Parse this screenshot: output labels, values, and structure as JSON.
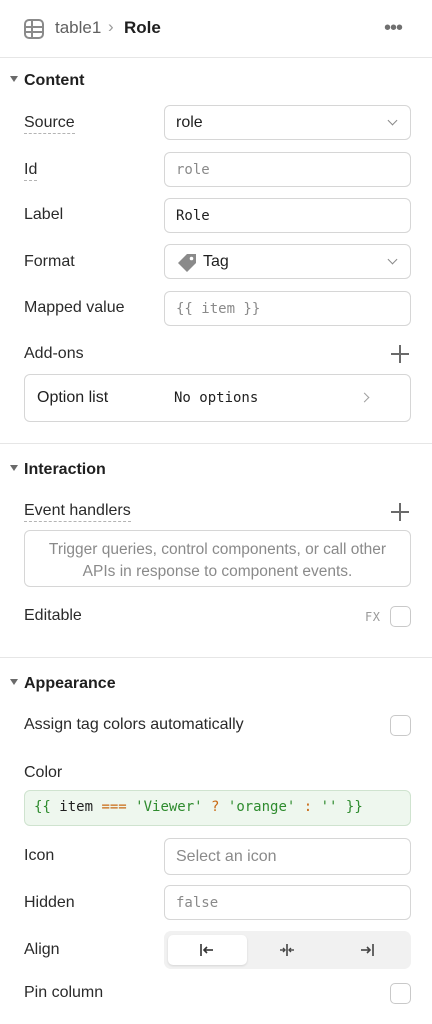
{
  "header": {
    "breadcrumb_parent": "table1",
    "breadcrumb_separator": "›",
    "breadcrumb_current": "Role",
    "more_icon": "more-horizontal-icon",
    "table_icon": "table-icon"
  },
  "content": {
    "title": "Content",
    "source": {
      "label": "Source",
      "value": "role"
    },
    "id": {
      "label": "Id",
      "placeholder": "role"
    },
    "label_field": {
      "label": "Label",
      "value": "Role"
    },
    "format": {
      "label": "Format",
      "value": "Tag",
      "icon": "tag-icon"
    },
    "mapped_value": {
      "label": "Mapped value",
      "placeholder": "{{ item }}"
    },
    "addons": {
      "label": "Add-ons"
    },
    "option_list": {
      "title": "Option list",
      "value": "No options"
    }
  },
  "interaction": {
    "title": "Interaction",
    "event_handlers": {
      "label": "Event handlers",
      "empty_text": "Trigger queries, control components, or call other APIs in response to component events."
    },
    "editable": {
      "label": "Editable",
      "fx": "FX",
      "checked": false
    }
  },
  "appearance": {
    "title": "Appearance",
    "assign_colors": {
      "label": "Assign tag colors automatically",
      "checked": false
    },
    "color": {
      "label": "Color",
      "tokens": {
        "open": "{{",
        "item": " item ",
        "op_eq": "===",
        "viewer": " 'Viewer' ",
        "op_q": "?",
        "orange": " 'orange' ",
        "op_colon": ":",
        "empty": " '' ",
        "close": "}}"
      }
    },
    "icon": {
      "label": "Icon",
      "placeholder": "Select an icon"
    },
    "hidden": {
      "label": "Hidden",
      "placeholder": "false"
    },
    "align": {
      "label": "Align",
      "options": [
        "align-left-icon",
        "align-center-icon",
        "align-right-icon"
      ],
      "selected": "left"
    },
    "pin_column": {
      "label": "Pin column",
      "checked": false
    }
  },
  "colors": {
    "code_bg": "#eef7ee",
    "code_string": "#2e8b2e",
    "code_operator": "#c96a14",
    "border": "#d6d6d6"
  }
}
